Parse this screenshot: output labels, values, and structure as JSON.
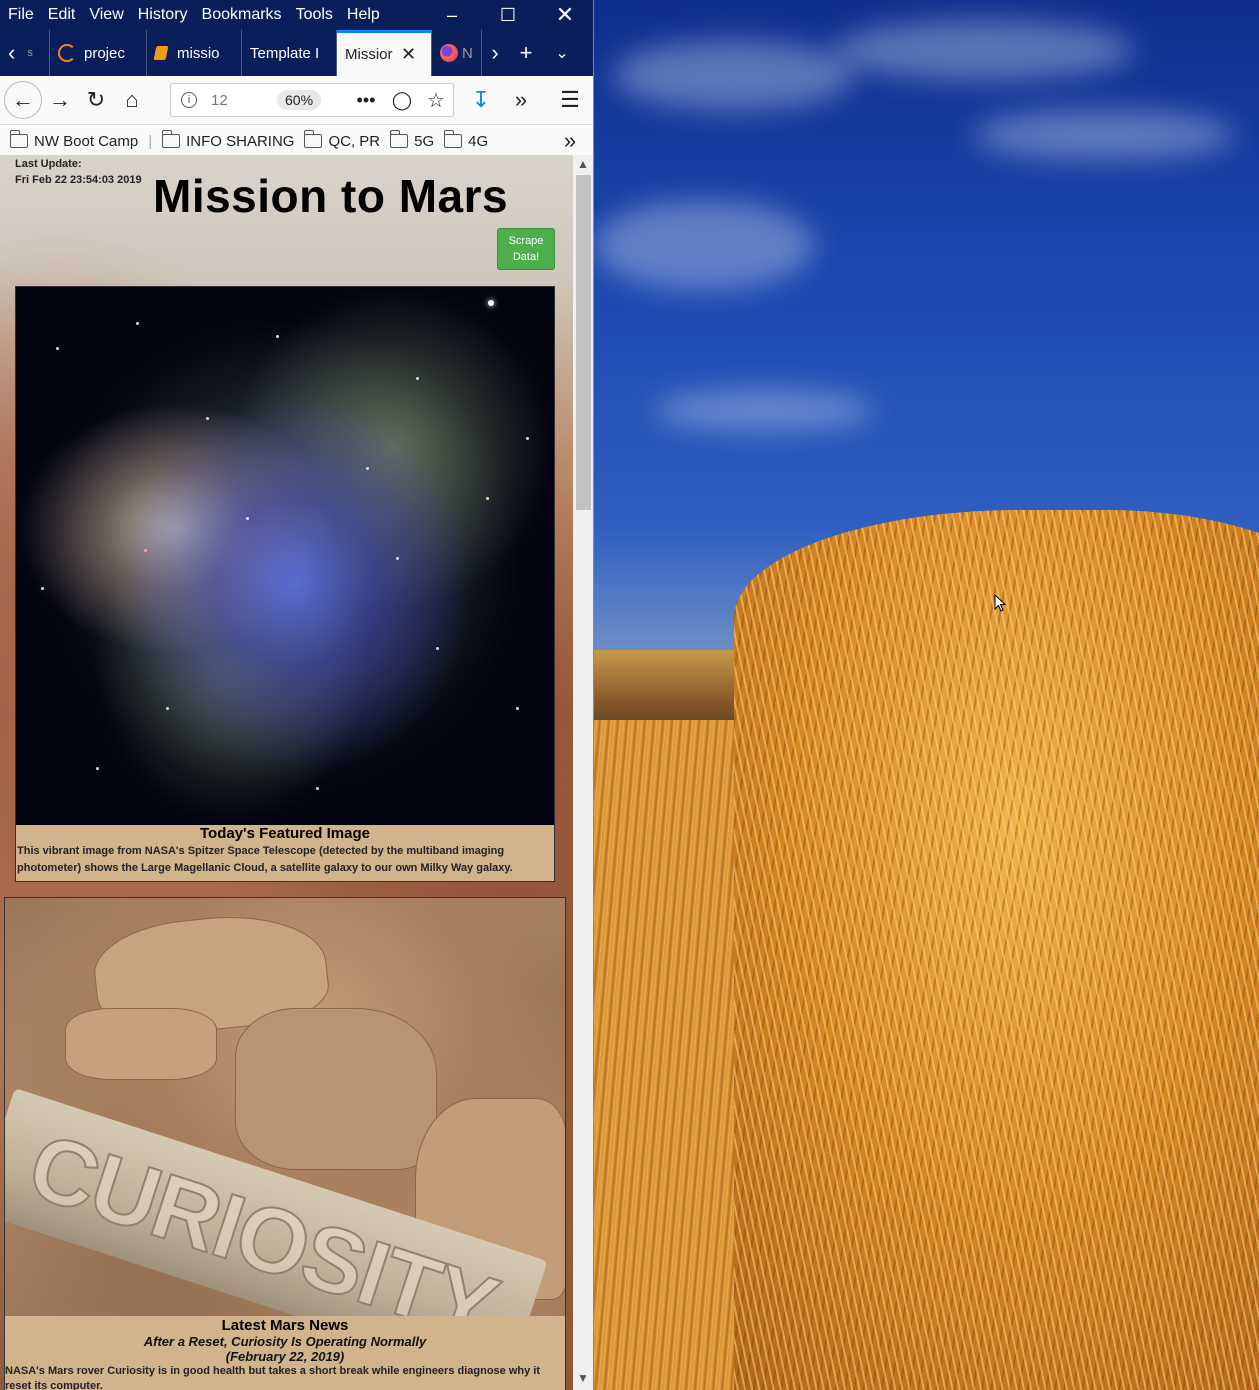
{
  "menubar": {
    "items": [
      "File",
      "Edit",
      "View",
      "History",
      "Bookmarks",
      "Tools",
      "Help"
    ]
  },
  "tabs": [
    {
      "label": "projec"
    },
    {
      "label": "missio"
    },
    {
      "label": "Template I"
    },
    {
      "label": "Missior",
      "active": true
    },
    {
      "label": "N"
    }
  ],
  "navbar": {
    "url": "12",
    "zoom": "60%"
  },
  "bookmarks": [
    "NW Boot Camp",
    "INFO SHARING",
    "QC, PR",
    "5G",
    "4G"
  ],
  "page": {
    "last_update_label": "Last Update:",
    "last_update_value": "Fri Feb 22 23:54:03 2019",
    "title": "Mission to Mars",
    "scrape_button": "Scrape Data!",
    "featured": {
      "title": "Today's Featured Image",
      "description": "This vibrant image from NASA's Spitzer Space Telescope (detected by the multiband imaging photometer) shows the Large Magellanic Cloud, a satellite galaxy to our own Milky Way galaxy."
    },
    "news": {
      "section_title": "Latest Mars News",
      "headline": "After a Reset, Curiosity Is Operating Normally",
      "date": "(February 22, 2019)",
      "body": "NASA's Mars rover Curiosity is in good health but takes a short break while engineers diagnose why it reset its computer.",
      "image_text": "CURIOSITY"
    }
  },
  "colors": {
    "titlebar": "#0a1f59",
    "scrape_button": "#4cae4c",
    "caption_bg": "#d2b48c"
  }
}
